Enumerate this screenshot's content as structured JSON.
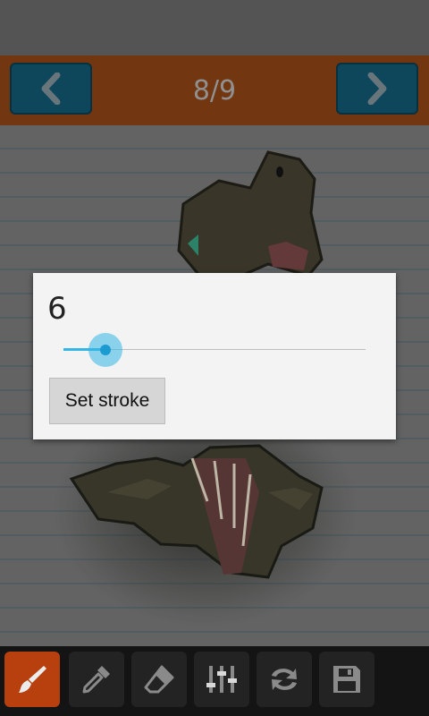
{
  "header": {
    "page_counter": "8/9",
    "prev_icon": "chevron-left-icon",
    "next_icon": "chevron-right-icon"
  },
  "dialog": {
    "stroke_value": "6",
    "slider_fraction": 0.14,
    "set_button_label": "Set stroke"
  },
  "toolbar": {
    "tools": [
      "brush-icon",
      "eyedropper-icon",
      "eraser-icon",
      "sliders-icon",
      "swap-icon",
      "save-icon"
    ],
    "active_tool": "brush-icon"
  },
  "colors": {
    "accent": "#33b5e5",
    "nav_button": "#0f4c62",
    "header_bar": "#7a3a13",
    "active_tool": "#b8400f"
  }
}
